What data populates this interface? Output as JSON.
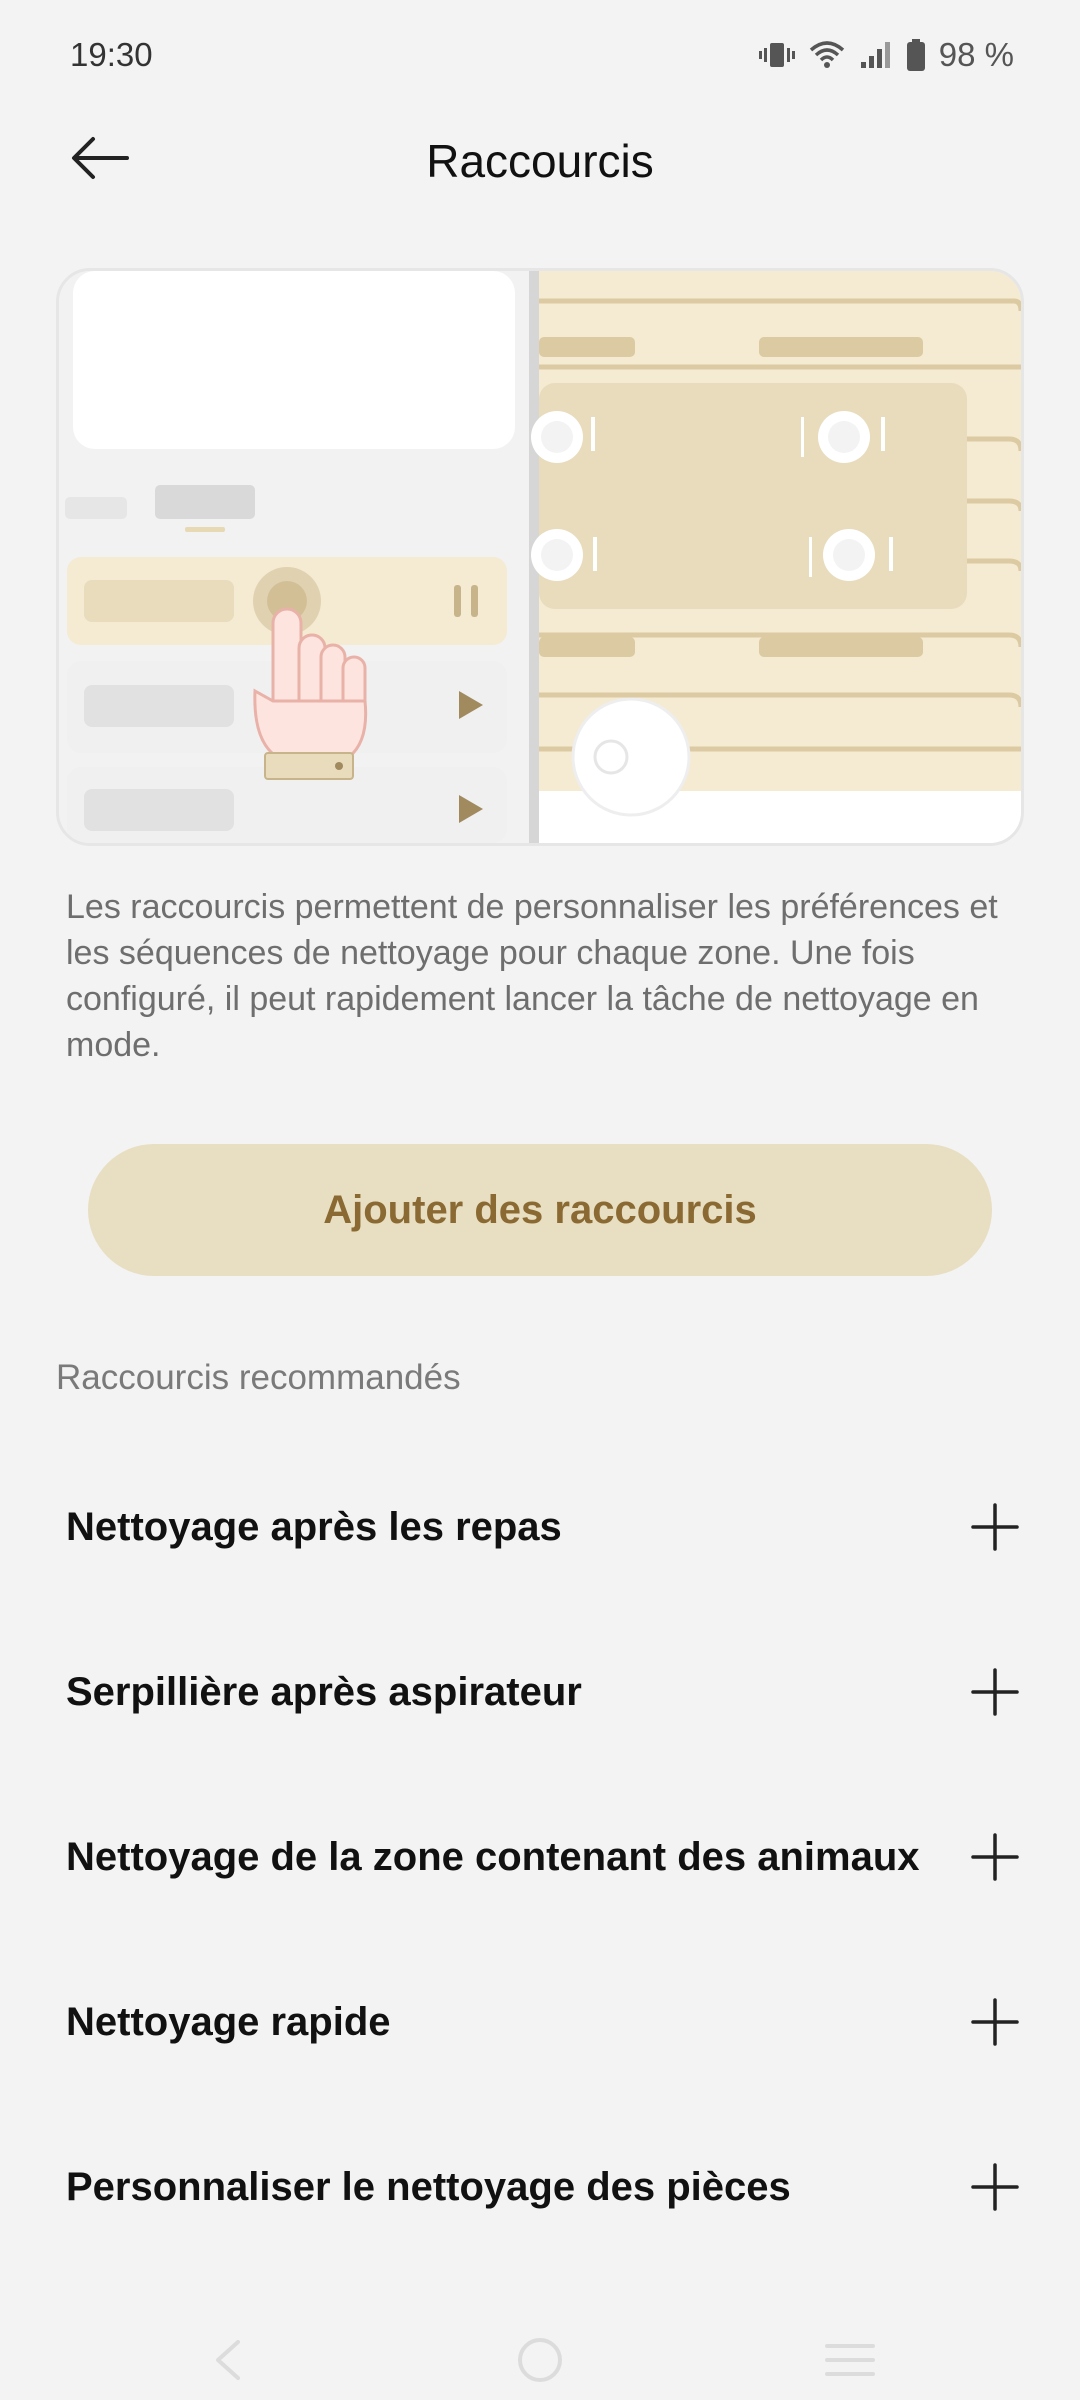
{
  "status_bar": {
    "time": "19:30",
    "battery": "98 %",
    "icons": [
      "vibrate-icon",
      "wifi-icon",
      "signal-icon",
      "battery-icon"
    ]
  },
  "header": {
    "title": "Raccourcis",
    "back_icon": "arrow-left-icon"
  },
  "intro": {
    "description": "Les raccourcis permettent de personnaliser les préférences et les séquences de nettoyage pour chaque zone. Une fois configuré, il peut rapidement lancer la tâche de nettoyage en mode."
  },
  "add_button": {
    "label": "Ajouter des raccourcis"
  },
  "recommended": {
    "title": "Raccourcis recommandés",
    "items": [
      {
        "label": "Nettoyage après les repas",
        "icon": "plus-icon"
      },
      {
        "label": "Serpillière après aspirateur",
        "icon": "plus-icon"
      },
      {
        "label": "Nettoyage de la zone contenant des animaux",
        "icon": "plus-icon"
      },
      {
        "label": "Nettoyage rapide",
        "icon": "plus-icon"
      },
      {
        "label": "Personnaliser le nettoyage des pièces",
        "icon": "plus-icon"
      }
    ]
  },
  "nav": {
    "icons": [
      "nav-back-icon",
      "nav-home-icon",
      "nav-recents-icon"
    ]
  },
  "colors": {
    "background": "#f3f3f3",
    "accent_fill": "#e8dec2",
    "accent_text": "#8a6a32"
  }
}
